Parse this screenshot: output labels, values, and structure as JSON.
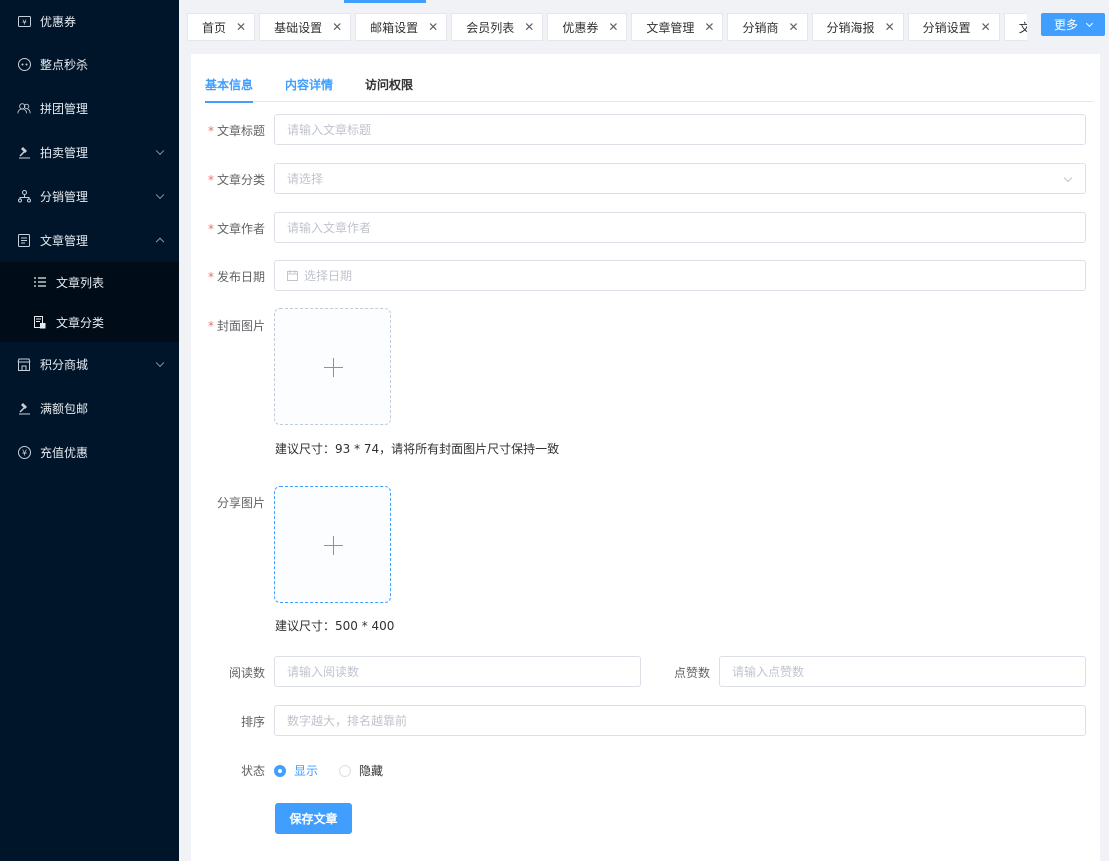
{
  "sidebar": {
    "items": [
      {
        "label": "优惠券",
        "icon": "coupon-icon"
      },
      {
        "label": "整点秒杀",
        "icon": "flash-sale-icon"
      },
      {
        "label": "拼团管理",
        "icon": "group-buy-icon"
      },
      {
        "label": "拍卖管理",
        "icon": "auction-hammer-icon"
      },
      {
        "label": "分销管理",
        "icon": "distribution-icon"
      },
      {
        "label": "文章管理",
        "icon": "article-icon"
      }
    ],
    "sub_items": [
      {
        "label": "文章列表",
        "icon": "list-icon"
      },
      {
        "label": "文章分类",
        "icon": "category-icon"
      }
    ],
    "items_after": [
      {
        "label": "积分商城",
        "icon": "store-icon"
      },
      {
        "label": "满额包邮",
        "icon": "free-shipping-icon"
      },
      {
        "label": "充值优惠",
        "icon": "yen-icon"
      }
    ]
  },
  "tabs": [
    "首页",
    "基础设置",
    "邮箱设置",
    "会员列表",
    "优惠券",
    "文章管理",
    "分销商",
    "分销海报",
    "分销设置",
    "文章分类"
  ],
  "more_label": "更多",
  "form_tabs": [
    "基本信息",
    "内容详情",
    "访问权限"
  ],
  "form": {
    "title_label": "文章标题",
    "title_placeholder": "请输入文章标题",
    "category_label": "文章分类",
    "category_placeholder": "请选择",
    "author_label": "文章作者",
    "author_placeholder": "请输入文章作者",
    "date_label": "发布日期",
    "date_placeholder": "选择日期",
    "cover_label": "封面图片",
    "cover_hint": "建议尺寸：93 * 74，请将所有封面图片尺寸保持一致",
    "share_label": "分享图片",
    "share_hint": "建议尺寸：500 * 400",
    "reads_label": "阅读数",
    "reads_placeholder": "请输入阅读数",
    "likes_label": "点赞数",
    "likes_placeholder": "请输入点赞数",
    "sort_label": "排序",
    "sort_placeholder": "数字越大，排名越靠前",
    "status_label": "状态",
    "status_options": [
      "显示",
      "隐藏"
    ],
    "status_selected": "显示",
    "save_label": "保存文章"
  },
  "colors": {
    "primary": "#409eff",
    "sidebar_bg": "#001529",
    "required": "#f56c6c"
  }
}
